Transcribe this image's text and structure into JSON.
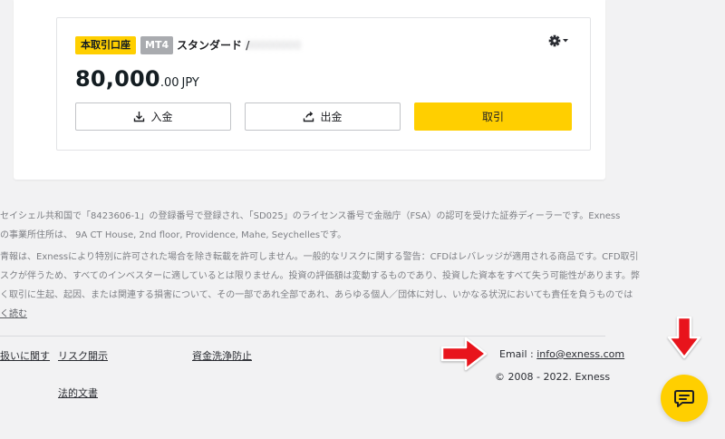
{
  "account": {
    "badge_real": "本取引口座",
    "badge_platform": "MT4",
    "type_label": "スタンダード /",
    "account_number": "00000000",
    "balance_integer": "80,000",
    "balance_decimal": ".00",
    "currency": "JPY",
    "buttons": {
      "deposit": "入金",
      "withdraw": "出金",
      "trade": "取引"
    }
  },
  "footer": {
    "legal_p1": [
      "セイシェル共和国で「8423606-1」の登録番号で登録され、「SD025」のライセンス番号で金融庁（FSA）の認可を受けた証券ディーラーです。Exness",
      "の事業所住所は、 9A CT House, 2nd floor, Providence, Mahe, Seychellesです。"
    ],
    "legal_p2": [
      "青報は、Exnessにより特別に許可された場合を除き転載を許可しません。一般的なリスクに関する警告：CFDはレバレッジが適用される商品です。CFD取引",
      "スクが伴うため、すべてのインベスターに適しているとは限りません。投資の評価額は変動するものであり、投資した資本をすべて失う可能性があります。弊",
      "く取引に生起、起因、または関連する損害について、その一部であれ全部であれ、あらゆる個人／団体に対し、いかなる状況においても責任を負うものでは"
    ],
    "read_more": "く読む",
    "links": {
      "privacy": "扱いに関す",
      "risk": "リスク開示",
      "aml": "資金洗浄防止",
      "legal_docs": "法的文書"
    },
    "email_label": "Email : ",
    "email": "info@exness.com",
    "copyright": "© 2008 - 2022. Exness"
  },
  "colors": {
    "accent": "#ffcf00",
    "annotation_arrow": "#e8141c"
  },
  "icons": {
    "settings": "gear-icon",
    "deposit": "download-icon",
    "withdraw": "upload-icon",
    "chat": "chat-icon"
  }
}
